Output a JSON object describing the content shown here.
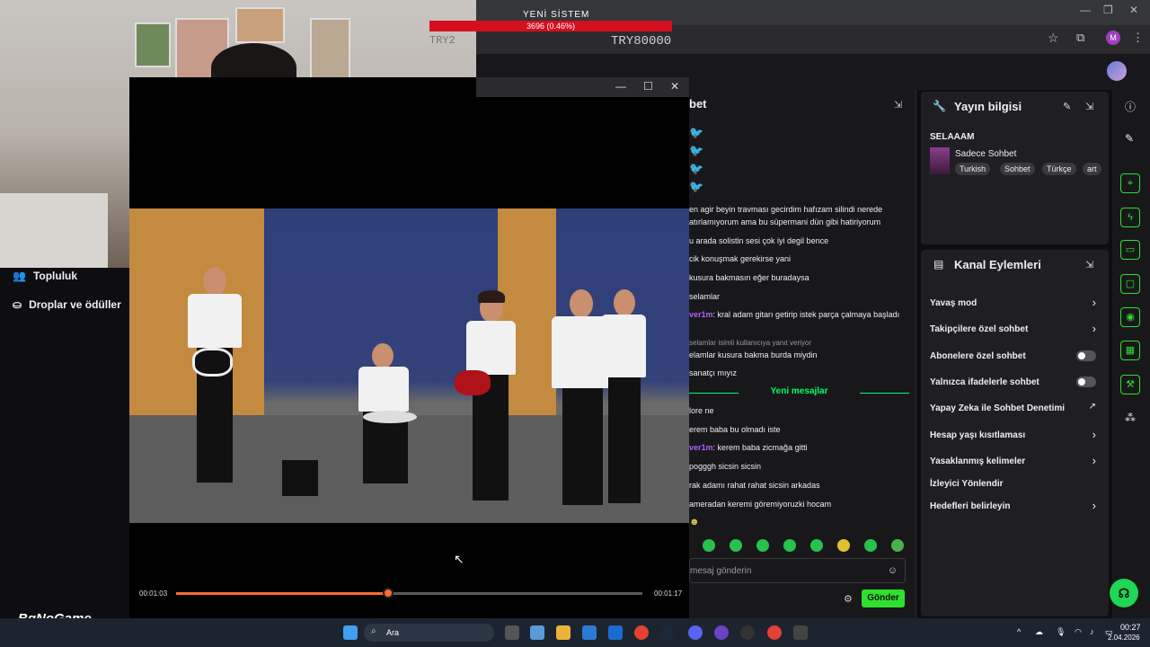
{
  "stream_overlay": {
    "goal_title": "YENİ SİSTEM",
    "goal_progress_text": "3696 (0.46%)",
    "goal_progress_fraction": 0.0046,
    "goal_amount": "TRY80000",
    "watermark_small": "TRY2"
  },
  "left_nav": {
    "items": [
      {
        "label": "Topluluk",
        "icon": "community-icon"
      },
      {
        "label": "Droplar ve ödüller",
        "icon": "drops-icon"
      }
    ]
  },
  "player": {
    "current_time": "00:01:03",
    "duration": "00:01:17",
    "progress_fraction": 0.455
  },
  "chat": {
    "title": "bet",
    "lines": [
      {
        "user": "",
        "text": "en agir beyin travması gecirdim hafızam silindi nerede"
      },
      {
        "user": "",
        "text": "atırlamıyorum ama bu süpermani dün gibi hatiriyorum"
      },
      {
        "user": "",
        "text": "u arada solistin sesi çok iyi degil bence"
      },
      {
        "user": "",
        "text": "cik konuşmak gerekirse yani"
      },
      {
        "user": "",
        "text": "kusura bakmasın eğer buradaysa"
      },
      {
        "user": "",
        "text": "selamlar"
      },
      {
        "user": "ver1m",
        "text": ": kral adam gitarı getirip istek parça çalmaya başladı"
      },
      {
        "user": "",
        "text": "selamlar isimli kullanıcıya yanıt veriyor"
      },
      {
        "user": "",
        "text": "elamlar kusura bakma burda miydin"
      },
      {
        "user": "",
        "text": "sanatçı mıyız"
      }
    ],
    "new_messages_label": "Yeni mesajlar",
    "new_lines": [
      {
        "user": "",
        "text": "lore ne"
      },
      {
        "user": "",
        "text": "erem baba bu olmadı iste"
      },
      {
        "user": "ver1m",
        "text": ": kerem baba zicmağa gitti"
      },
      {
        "user": "",
        "text": "pogggh sicsin sicsin"
      },
      {
        "user": "",
        "text": "rak adamı rahat rahat sicsin arkadas"
      },
      {
        "user": "",
        "text": "ameradan keremi göremiyoruzki hocam"
      }
    ],
    "input_placeholder": "mesaj gönderin",
    "send_label": "Gönder"
  },
  "stream_info": {
    "title": "Yayın bilgisi",
    "stream_title": "SELAAAM",
    "category": "Sadece Sohbet",
    "tags": [
      "Turkish",
      "Sohbet",
      "Türkçe",
      "art"
    ]
  },
  "channel_actions": {
    "title": "Kanal Eylemleri",
    "items": [
      {
        "label": "Yavaş mod",
        "control": "chevron"
      },
      {
        "label": "Takipçilere özel sohbet",
        "control": "chevron"
      },
      {
        "label": "Abonelere özel sohbet",
        "control": "toggle"
      },
      {
        "label": "Yalnızca ifadelerle sohbet",
        "control": "toggle"
      },
      {
        "label": "Yapay Zeka ile Sohbet Denetimi",
        "control": "external"
      },
      {
        "label": "Hesap yaşı kısıtlaması",
        "control": "chevron"
      },
      {
        "label": "Yasaklanmış kelimeler",
        "control": "chevron"
      },
      {
        "label": "İzleyici Yönlendir",
        "control": "none"
      },
      {
        "label": "Hedefleri belirleyin",
        "control": "chevron"
      }
    ]
  },
  "taskbar": {
    "search_label": "Ara",
    "time": "00:27",
    "date": "2.04.2026"
  },
  "watermark": "BgNoGame",
  "colors": {
    "accent_green": "#2ee02e",
    "goal_red": "#d40f1f",
    "progress_orange": "#ff6b2c",
    "username_purple": "#b060ff"
  }
}
